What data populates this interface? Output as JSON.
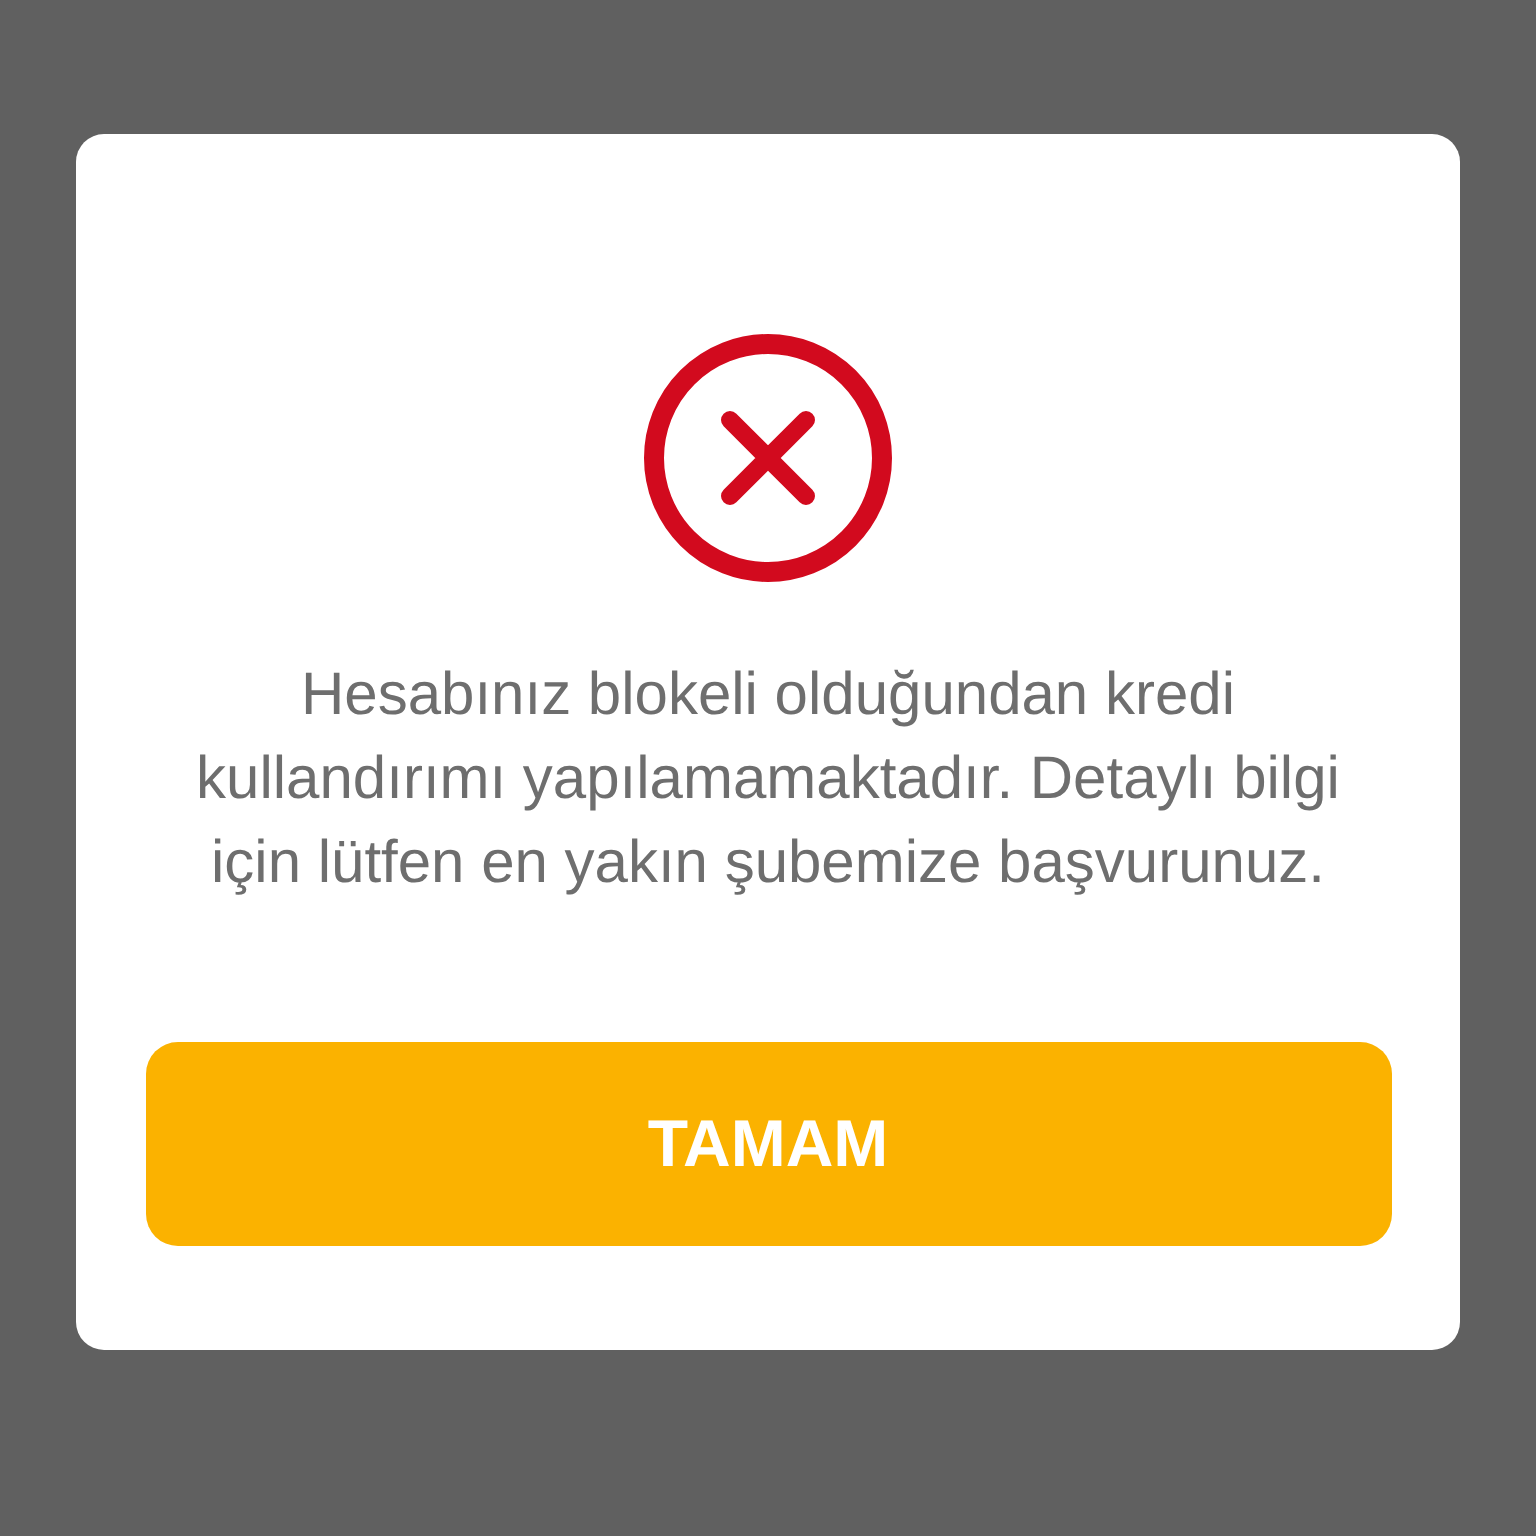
{
  "dialog": {
    "kind": "error",
    "message": "Hesabınız blokeli olduğundan kredi kullandırımı yapılamamaktadır. Detaylı bilgi için lütfen en yakın şubemize başvurunuz.",
    "button": "TAMAM"
  }
}
